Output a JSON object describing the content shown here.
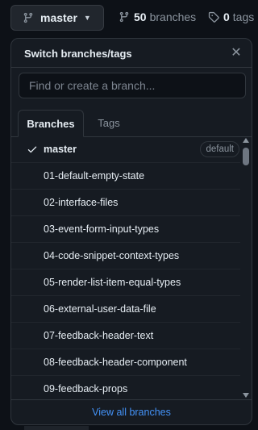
{
  "header": {
    "branch_button_label": "master",
    "branches_count": "50",
    "branches_label": "branches",
    "tags_count": "0",
    "tags_label": "tags"
  },
  "panel": {
    "title": "Switch branches/tags",
    "search_placeholder": "Find or create a branch...",
    "tabs": [
      {
        "label": "Branches",
        "active": true
      },
      {
        "label": "Tags",
        "active": false
      }
    ],
    "branches": [
      {
        "name": "master",
        "selected": true,
        "badge": "default"
      },
      {
        "name": "01-default-empty-state"
      },
      {
        "name": "02-interface-files"
      },
      {
        "name": "03-event-form-input-types"
      },
      {
        "name": "04-code-snippet-context-types"
      },
      {
        "name": "05-render-list-item-equal-types"
      },
      {
        "name": "06-external-user-data-file"
      },
      {
        "name": "07-feedback-header-text"
      },
      {
        "name": "08-feedback-header-component"
      },
      {
        "name": "09-feedback-props"
      }
    ],
    "view_all_label": "View all branches"
  },
  "icons": {
    "branch": "git-branch-icon",
    "tag": "tag-icon",
    "close": "close-icon",
    "check": "check-icon",
    "caret": "caret-down-icon"
  },
  "colors": {
    "background": "#0d1117",
    "panel": "#161b22",
    "border": "#30363d",
    "link": "#4493f8",
    "muted": "#8b949e"
  }
}
